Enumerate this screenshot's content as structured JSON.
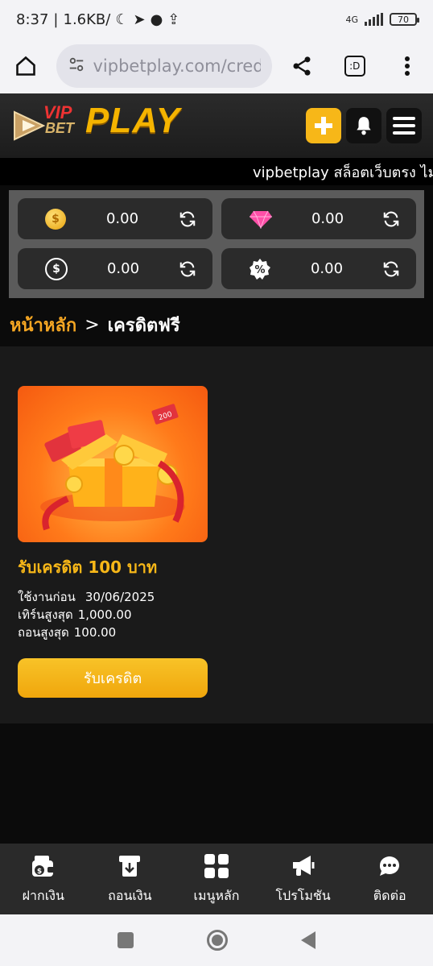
{
  "status_bar": {
    "time": "8:37",
    "speed": "1.6KB/",
    "network": "4G",
    "battery": "70"
  },
  "browser": {
    "url": "vipbetplay.com/creditf..",
    "tab_count": ":D"
  },
  "header": {
    "logo_vip": "VIP",
    "logo_bet": "BET",
    "logo_play": "PLAY"
  },
  "marquee": {
    "text": "vipbetplay สล็อตเว็บตรง ไม่ผ"
  },
  "wallet": {
    "items": [
      {
        "icon": "coin-icon",
        "value": "0.00"
      },
      {
        "icon": "diamond-icon",
        "value": "0.00"
      },
      {
        "icon": "cashback-icon",
        "value": "0.00"
      },
      {
        "icon": "percent-badge-icon",
        "value": "0.00"
      }
    ]
  },
  "breadcrumb": {
    "home": "หน้าหลัก",
    "separator": ">",
    "current": "เครดิตฟรี"
  },
  "card": {
    "title": "รับเครดิต 100 บาท",
    "use_before_label": "ใช้งานก่อน",
    "use_before_value": "30/06/2025",
    "turnover_label": "เทิร์นสูงสุด",
    "turnover_value": "1,000.00",
    "withdraw_label": "ถอนสูงสุด",
    "withdraw_value": "100.00",
    "button_label": "รับเครดิต",
    "ticket_label": "200"
  },
  "bottom_nav": {
    "items": [
      {
        "label": "ฝากเงิน",
        "icon": "deposit-wallet-icon"
      },
      {
        "label": "ถอนเงิน",
        "icon": "withdraw-icon"
      },
      {
        "label": "เมนูหลัก",
        "icon": "grid-menu-icon"
      },
      {
        "label": "โปรโมชัน",
        "icon": "megaphone-icon"
      },
      {
        "label": "ติดต่อ",
        "icon": "support-chat-icon"
      }
    ]
  },
  "colors": {
    "accent": "#f7b718",
    "background": "#0b0b0b",
    "card_bg": "#1a1a1a",
    "breadcrumb_home": "#f5a623"
  }
}
